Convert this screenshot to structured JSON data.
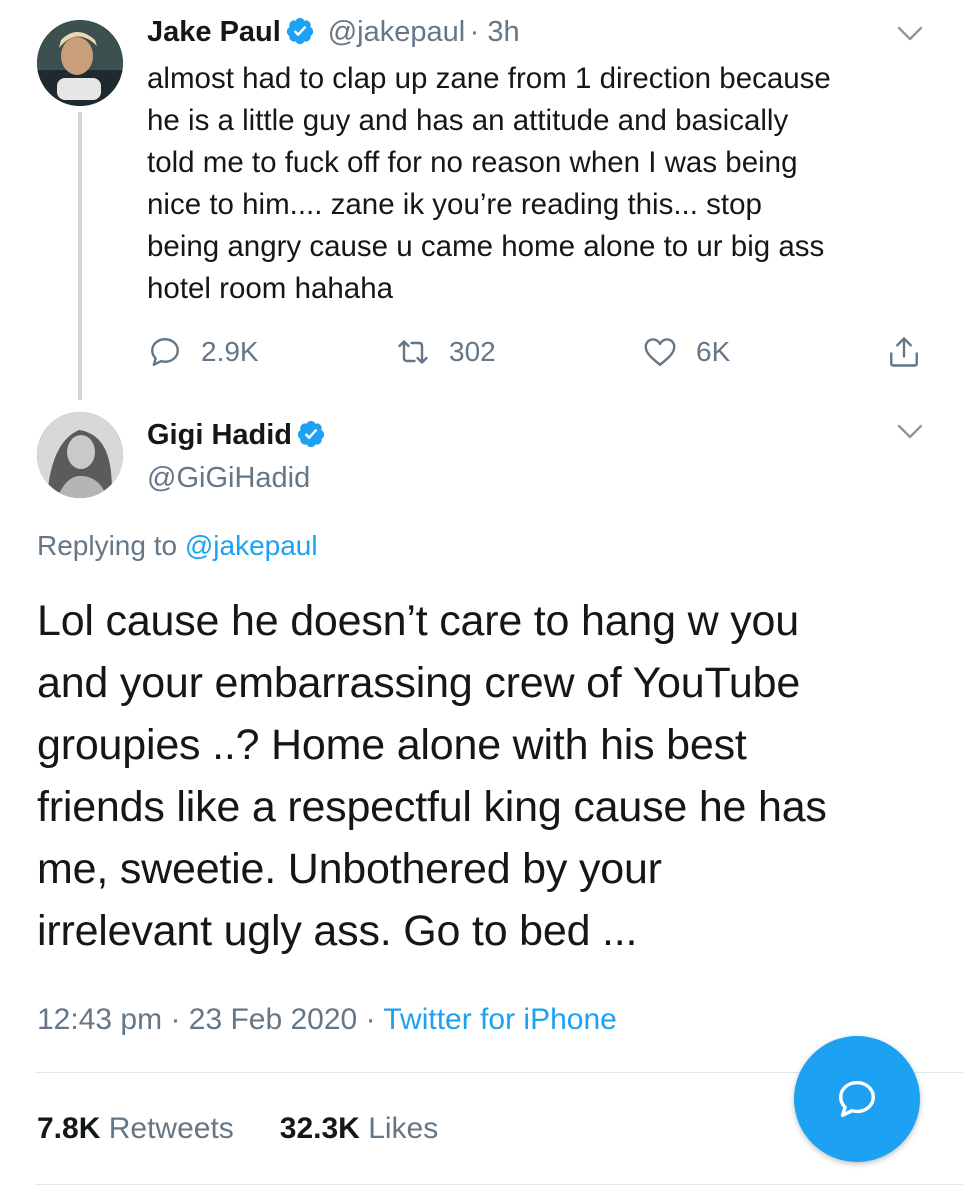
{
  "original_tweet": {
    "name": "Jake Paul",
    "handle": "@jakepaul",
    "time": "3h",
    "text": "almost had to clap up zane from 1 direction because\nhe is a little guy and has an attitude and basically\ntold me to fuck off for no reason when I was being\nnice to him.... zane ik you’re reading this... stop\nbeing angry cause u came home alone to ur big ass\nhotel room hahaha",
    "replies": "2.9K",
    "retweets": "302",
    "likes": "6K"
  },
  "reply_tweet": {
    "name": "Gigi Hadid",
    "handle": "@GiGiHadid",
    "replying_prefix": "Replying to",
    "replying_to": "@jakepaul",
    "text": "Lol cause he doesn’t care to hang w you\nand your embarrassing crew of YouTube\ngroupies ..? Home alone with his best\nfriends like a respectful king cause he has\nme, sweetie. Unbothered by your\nirrelevant ugly ass. Go to bed ...",
    "time": "12:43 pm",
    "date": "23 Feb 2020",
    "source": "Twitter for iPhone",
    "retweet_count": "7.8K",
    "retweet_label": "Retweets",
    "like_count": "32.3K",
    "like_label": "Likes"
  },
  "icons": {
    "verified": "verified-badge-icon",
    "reply": "reply-icon",
    "retweet": "retweet-icon",
    "like": "heart-icon",
    "share": "share-icon",
    "compose_reply": "compose-reply-icon"
  },
  "colors": {
    "accent": "#1da1f2",
    "secondary_text": "#657786",
    "primary_text": "#14171a"
  }
}
